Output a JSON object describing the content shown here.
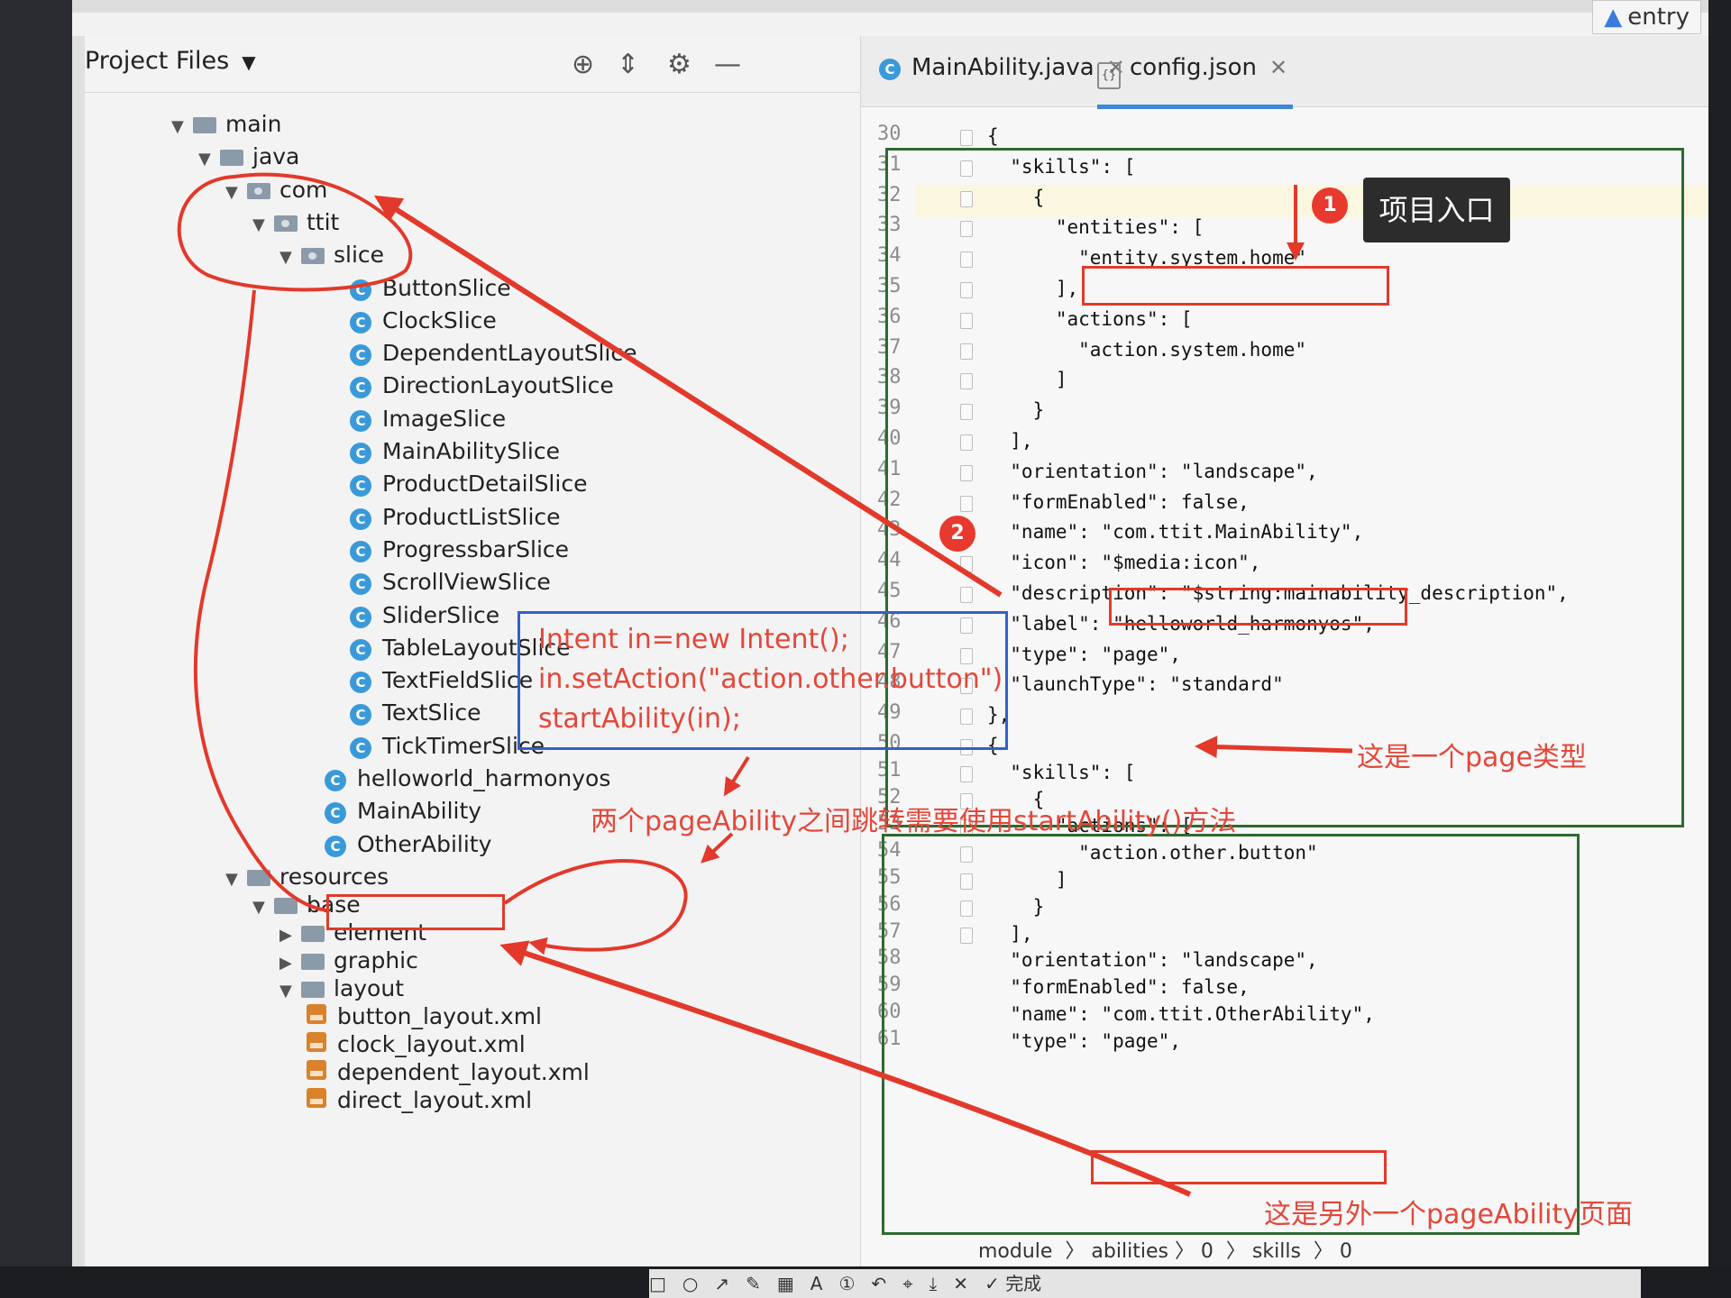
{
  "topbar": {
    "entry_label": "entry"
  },
  "project_panel": {
    "title": "Project Files",
    "tree": [
      {
        "label": "main",
        "type": "folder",
        "expanded": true
      },
      {
        "label": "java",
        "type": "folder",
        "expanded": true
      },
      {
        "label": "com",
        "type": "package",
        "expanded": true
      },
      {
        "label": "ttit",
        "type": "package",
        "expanded": true
      },
      {
        "label": "slice",
        "type": "package",
        "expanded": true
      },
      {
        "label": "ButtonSlice",
        "type": "class"
      },
      {
        "label": "ClockSlice",
        "type": "class"
      },
      {
        "label": "DependentLayoutSlice",
        "type": "class"
      },
      {
        "label": "DirectionLayoutSlice",
        "type": "class"
      },
      {
        "label": "ImageSlice",
        "type": "class"
      },
      {
        "label": "MainAbilitySlice",
        "type": "class"
      },
      {
        "label": "ProductDetailSlice",
        "type": "class"
      },
      {
        "label": "ProductListSlice",
        "type": "class"
      },
      {
        "label": "ProgressbarSlice",
        "type": "class"
      },
      {
        "label": "ScrollViewSlice",
        "type": "class"
      },
      {
        "label": "SliderSlice",
        "type": "class"
      },
      {
        "label": "TableLayoutSlice",
        "type": "class"
      },
      {
        "label": "TextFieldSlice",
        "type": "class"
      },
      {
        "label": "TextSlice",
        "type": "class"
      },
      {
        "label": "TickTimerSlice",
        "type": "class"
      },
      {
        "label": "helloworld_harmonyos",
        "type": "class"
      },
      {
        "label": "MainAbility",
        "type": "class"
      },
      {
        "label": "OtherAbility",
        "type": "class"
      },
      {
        "label": "resources",
        "type": "folder",
        "expanded": true
      },
      {
        "label": "base",
        "type": "folder",
        "expanded": true
      },
      {
        "label": "element",
        "type": "folder",
        "expanded": false
      },
      {
        "label": "graphic",
        "type": "folder",
        "expanded": false
      },
      {
        "label": "layout",
        "type": "folder",
        "expanded": true
      },
      {
        "label": "button_layout.xml",
        "type": "xml"
      },
      {
        "label": "clock_layout.xml",
        "type": "xml"
      },
      {
        "label": "dependent_layout.xml",
        "type": "xml"
      },
      {
        "label": "direct_layout.xml",
        "type": "xml"
      }
    ]
  },
  "editor": {
    "tabs": [
      {
        "label": "MainAbility.java",
        "active": false
      },
      {
        "label": "config.json",
        "active": true
      }
    ],
    "line_numbers": [
      "30",
      "31",
      "32",
      "33",
      "34",
      "35",
      "36",
      "37",
      "38",
      "39",
      "40",
      "41",
      "42",
      "43",
      "44",
      "45",
      "46",
      "47",
      "48",
      "49",
      "50",
      "51",
      "52",
      "53",
      "54",
      "55",
      "56",
      "57",
      "58",
      "59",
      "60",
      "61"
    ],
    "lines": [
      "{",
      "  \"skills\": [",
      "    {",
      "      \"entities\": [",
      "        \"entity.system.home\"",
      "      ],",
      "      \"actions\": [",
      "        \"action.system.home\"",
      "      ]",
      "    }",
      "  ],",
      "  \"orientation\": \"landscape\",",
      "  \"formEnabled\": false,",
      "  \"name\": \"com.ttit.MainAbility\",",
      "  \"icon\": \"$media:icon\",",
      "  \"description\": \"$string:mainability_description\",",
      "  \"label\": \"helloworld_harmonyos\",",
      "  \"type\": \"page\",",
      "  \"launchType\": \"standard\"",
      "},",
      "{",
      "  \"skills\": [",
      "    {",
      "      \"actions\": [",
      "        \"action.other.button\"",
      "      ]",
      "    }",
      "  ],",
      "  \"orientation\": \"landscape\",",
      "  \"formEnabled\": false,",
      "  \"name\": \"com.ttit.OtherAbility\",",
      "  \"type\": \"page\","
    ],
    "breadcrumb": "module  〉 abilities 〉 0  〉 skills  〉 0"
  },
  "annotations": {
    "badge1": "1",
    "badge1_label": "项目入口",
    "badge2": "2",
    "code_snippet": [
      "Intent in=new Intent();",
      "in.setAction(\"action.other.button\")",
      "startAbility(in);"
    ],
    "note_jump": "两个pageAbility之间跳转需要使用startAbility()方法",
    "note_page_type": "这是一个page类型",
    "note_other_page": "这是另外一个pageAbility页面"
  },
  "bottom_toolbar": {
    "done_label": "完成"
  },
  "colors": {
    "annotation_red": "#e2392b",
    "box_green": "#2f6a2f",
    "box_blue": "#3360c8",
    "tab_accent": "#3c87d6"
  }
}
